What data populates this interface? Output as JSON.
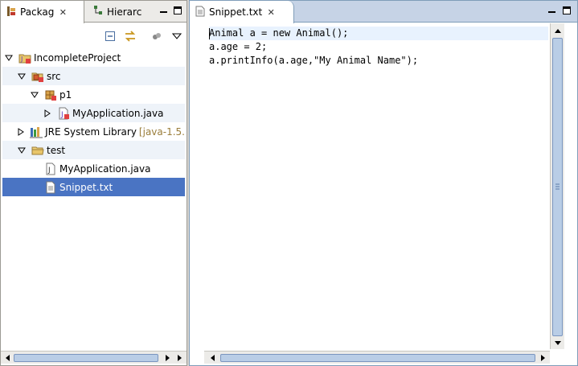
{
  "package_explorer": {
    "tab_label": "Packag",
    "tab2_label": "Hierarc",
    "tree": [
      {
        "label": "IncompleteProject",
        "icon": "java-project-icon",
        "twisty": "expanded",
        "indent": 0,
        "state": "normal"
      },
      {
        "label": "src",
        "icon": "source-folder-icon",
        "twisty": "expanded",
        "indent": 1,
        "state": "alt"
      },
      {
        "label": "p1",
        "icon": "package-icon",
        "twisty": "expanded",
        "indent": 2,
        "state": "normal"
      },
      {
        "label": "MyApplication.java",
        "icon": "java-file-icon",
        "twisty": "collapsed",
        "indent": 3,
        "state": "alt"
      },
      {
        "label": "JRE System Library",
        "decoration": "[java-1.5.",
        "icon": "library-icon",
        "twisty": "collapsed",
        "indent": 1,
        "state": "normal"
      },
      {
        "label": "test",
        "icon": "folder-icon",
        "twisty": "expanded",
        "indent": 1,
        "state": "alt"
      },
      {
        "label": "MyApplication.java",
        "icon": "file-icon",
        "twisty": "none",
        "indent": 2,
        "state": "normal"
      },
      {
        "label": "Snippet.txt",
        "icon": "text-file-icon",
        "twisty": "none",
        "indent": 2,
        "state": "selected"
      }
    ]
  },
  "editor": {
    "tab_label": "Snippet.txt",
    "lines": [
      "Animal a = new Animal();",
      "a.age = 2;",
      "a.printInfo(a.age,\"My Animal Name\");"
    ]
  },
  "colors": {
    "selection": "#4a74c3",
    "current_line": "#e8f2fe",
    "scroll_thumb": "#b9cde6",
    "chrome": "#d6d3ce"
  }
}
